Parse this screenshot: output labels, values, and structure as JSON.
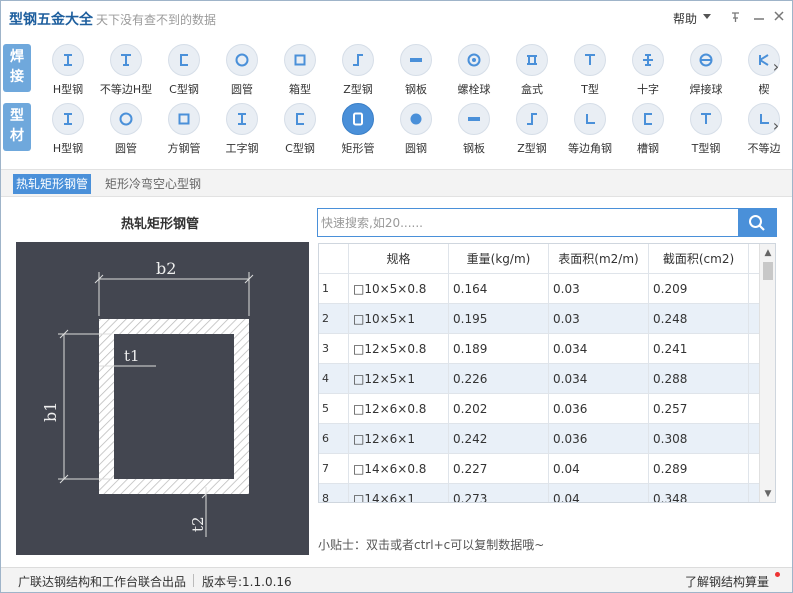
{
  "app": {
    "title": "型钢五金大全",
    "slogan": "天下没有查不到的数据",
    "help_label": "帮助",
    "pin_icon": "pin-icon",
    "minimize_icon": "minimize-icon",
    "close_icon": "close-icon"
  },
  "welding_row": {
    "tag": [
      "焊",
      "接"
    ],
    "items": [
      {
        "label": "H型钢",
        "icon": "h-beam-icon"
      },
      {
        "label": "不等边H型",
        "icon": "unequal-h-icon"
      },
      {
        "label": "C型钢",
        "icon": "c-channel-icon"
      },
      {
        "label": "圆管",
        "icon": "round-tube-icon"
      },
      {
        "label": "箱型",
        "icon": "box-section-icon"
      },
      {
        "label": "Z型钢",
        "icon": "z-section-icon"
      },
      {
        "label": "钢板",
        "icon": "steel-plate-icon"
      },
      {
        "label": "螺栓球",
        "icon": "bolt-ball-icon"
      },
      {
        "label": "盒式",
        "icon": "box-type-icon"
      },
      {
        "label": "T型",
        "icon": "t-section-icon"
      },
      {
        "label": "十字",
        "icon": "cross-section-icon"
      },
      {
        "label": "焊接球",
        "icon": "welded-ball-icon"
      },
      {
        "label": "楔",
        "icon": "wedge-icon"
      }
    ]
  },
  "profile_row": {
    "tag": [
      "型",
      "材"
    ],
    "items": [
      {
        "label": "H型钢",
        "icon": "h-beam-icon"
      },
      {
        "label": "圆管",
        "icon": "round-tube-icon"
      },
      {
        "label": "方钢管",
        "icon": "square-tube-icon"
      },
      {
        "label": "工字钢",
        "icon": "i-beam-icon"
      },
      {
        "label": "C型钢",
        "icon": "c-channel-icon"
      },
      {
        "label": "矩形管",
        "icon": "rect-tube-icon",
        "active": true
      },
      {
        "label": "圆钢",
        "icon": "round-bar-icon"
      },
      {
        "label": "钢板",
        "icon": "steel-plate-icon"
      },
      {
        "label": "Z型钢",
        "icon": "z-section-icon"
      },
      {
        "label": "等边角钢",
        "icon": "equal-angle-icon"
      },
      {
        "label": "槽钢",
        "icon": "channel-icon"
      },
      {
        "label": "T型钢",
        "icon": "t-section-icon"
      },
      {
        "label": "不等边",
        "icon": "unequal-angle-icon"
      }
    ]
  },
  "subtabs": [
    {
      "label": "热轧矩形钢管",
      "active": true
    },
    {
      "label": "矩形冷弯空心型钢",
      "active": false
    }
  ],
  "diagram": {
    "title": "热轧矩形钢管",
    "labels": {
      "b2": "b2",
      "t1": "t1",
      "b1": "b1",
      "t2": "t2"
    }
  },
  "search": {
    "placeholder": "快速搜索,如20......",
    "icon": "search-icon"
  },
  "table": {
    "headers": [
      "规格",
      "重量(kg/m)",
      "表面积(m2/m)",
      "截面积(cm2)"
    ],
    "rows": [
      {
        "idx": "1",
        "spec": "□10×5×0.8",
        "weight": "0.164",
        "surface": "0.03",
        "area": "0.209"
      },
      {
        "idx": "2",
        "spec": "□10×5×1",
        "weight": "0.195",
        "surface": "0.03",
        "area": "0.248"
      },
      {
        "idx": "3",
        "spec": "□12×5×0.8",
        "weight": "0.189",
        "surface": "0.034",
        "area": "0.241"
      },
      {
        "idx": "4",
        "spec": "□12×5×1",
        "weight": "0.226",
        "surface": "0.034",
        "area": "0.288"
      },
      {
        "idx": "5",
        "spec": "□12×6×0.8",
        "weight": "0.202",
        "surface": "0.036",
        "area": "0.257"
      },
      {
        "idx": "6",
        "spec": "□12×6×1",
        "weight": "0.242",
        "surface": "0.036",
        "area": "0.308"
      },
      {
        "idx": "7",
        "spec": "□14×6×0.8",
        "weight": "0.227",
        "surface": "0.04",
        "area": "0.289"
      },
      {
        "idx": "8",
        "spec": "□14×6×1",
        "weight": "0.273",
        "surface": "0.04",
        "area": "0.348"
      }
    ]
  },
  "tip": "小贴士：双击或者ctrl+c可以复制数据哦~",
  "status": {
    "left": "广联达钢结构和工作台联合出品",
    "version": "版本号:1.1.0.16",
    "right": "了解钢结构算量"
  },
  "colors": {
    "accent": "#4a90d9",
    "tag": "#6fa8dc",
    "diagram_bg": "#434650",
    "row_alt": "#e9f0f8"
  }
}
